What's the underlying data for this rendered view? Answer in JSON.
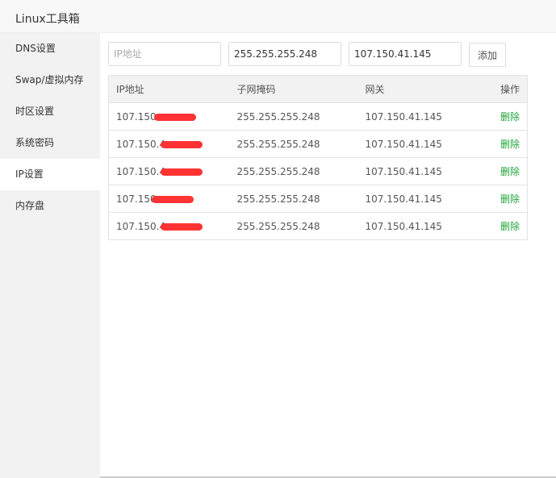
{
  "title": "Linux工具箱",
  "sidebar": {
    "items": [
      {
        "label": "DNS设置"
      },
      {
        "label": "Swap/虚拟内存"
      },
      {
        "label": "时区设置"
      },
      {
        "label": "系统密码"
      },
      {
        "label": "IP设置"
      },
      {
        "label": "内存盘"
      }
    ],
    "active": "IP设置"
  },
  "form": {
    "ip_placeholder": "IP地址",
    "ip_value": "",
    "mask_value": "255.255.255.248",
    "gateway_value": "107.150.41.145",
    "add_label": "添加"
  },
  "table": {
    "headers": [
      "IP地址",
      "子网掩码",
      "网关",
      "操作"
    ],
    "rows": [
      {
        "ip": "107.150.",
        "mask": "255.255.255.248",
        "gateway": "107.150.41.145",
        "action": "删除"
      },
      {
        "ip": "107.150.4",
        "mask": "255.255.255.248",
        "gateway": "107.150.41.145",
        "action": "删除"
      },
      {
        "ip": "107.150.4",
        "mask": "255.255.255.248",
        "gateway": "107.150.41.145",
        "action": "删除"
      },
      {
        "ip": "107.150",
        "mask": "255.255.255.248",
        "gateway": "107.150.41.145",
        "action": "删除"
      },
      {
        "ip": "107.150.4",
        "mask": "255.255.255.248",
        "gateway": "107.150.41.145",
        "action": "删除"
      }
    ]
  },
  "colors": {
    "accent": "#20a53a",
    "redaction": "#ff3333"
  }
}
